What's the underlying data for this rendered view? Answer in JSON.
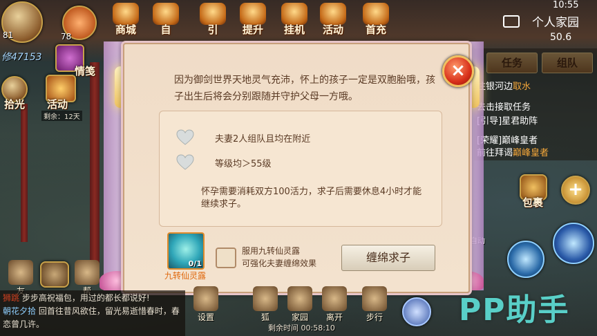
{
  "status_bar": {
    "time": "10:55"
  },
  "player": {
    "level": "81",
    "power": "修47153",
    "pet_level": "78"
  },
  "top_menu": [
    {
      "label": "商城"
    },
    {
      "label": "自"
    },
    {
      "label": "引"
    },
    {
      "label": "提升"
    },
    {
      "label": "挂机"
    },
    {
      "label": "活动"
    },
    {
      "label": "首充"
    }
  ],
  "left_menu": {
    "qingjian": "情笺",
    "shiguang": "拾光",
    "huodong": "活动",
    "huodong_remain": "剩余：12天"
  },
  "home": {
    "label": "个人家园",
    "coords": "50.6"
  },
  "quest_tabs": {
    "task": "任务",
    "team": "组队"
  },
  "quests": [
    {
      "text": "往银河边",
      "highlight": "取水"
    },
    {
      "text": "去击接取任务",
      "highlight": ""
    },
    {
      "text": "[引导]星君助阵",
      "highlight": ""
    },
    {
      "text": "[荣耀]巅峰皇者",
      "highlight": ""
    },
    {
      "text": "前往拜谒",
      "highlight": "巅峰皇者"
    }
  ],
  "dialog": {
    "intro": "因为御剑世界天地灵气充沛，怀上的孩子一定是双胞胎哦，孩子出生后将会分别跟随并守护父母一方哦。",
    "requirements": [
      "夫妻2人组队且均在附近",
      "等级均＞55级"
    ],
    "note": "怀孕需要消耗双方100活力，求子后需要休息4小时才能继续求子。",
    "item_name": "九转仙灵露",
    "item_count": "0/1",
    "checkbox_text_1": "服用九转仙灵露",
    "checkbox_text_2": "可强化夫妻缠绵效果",
    "action_button": "缠绵求子",
    "close": "×"
  },
  "right_side": {
    "bag": "包裹",
    "auto": "自动"
  },
  "chat": {
    "line1_tag": "狮跳",
    "line1_text": "步步高祝福包，用过的都长都说好!",
    "line2_name": "朝花夕拾",
    "line2_text": "回首往昔风欲住，留光易逝惜春时，春恋曾几许。",
    "friends": "友",
    "help": "帮"
  },
  "bottom_bar": [
    {
      "label": "设置"
    },
    {
      "label": "狐"
    },
    {
      "label": "家园"
    },
    {
      "label": "离开"
    },
    {
      "label": "步行"
    }
  ],
  "bottom_timer": "剩余时间 00:58:10",
  "watermark": "PP助手"
}
